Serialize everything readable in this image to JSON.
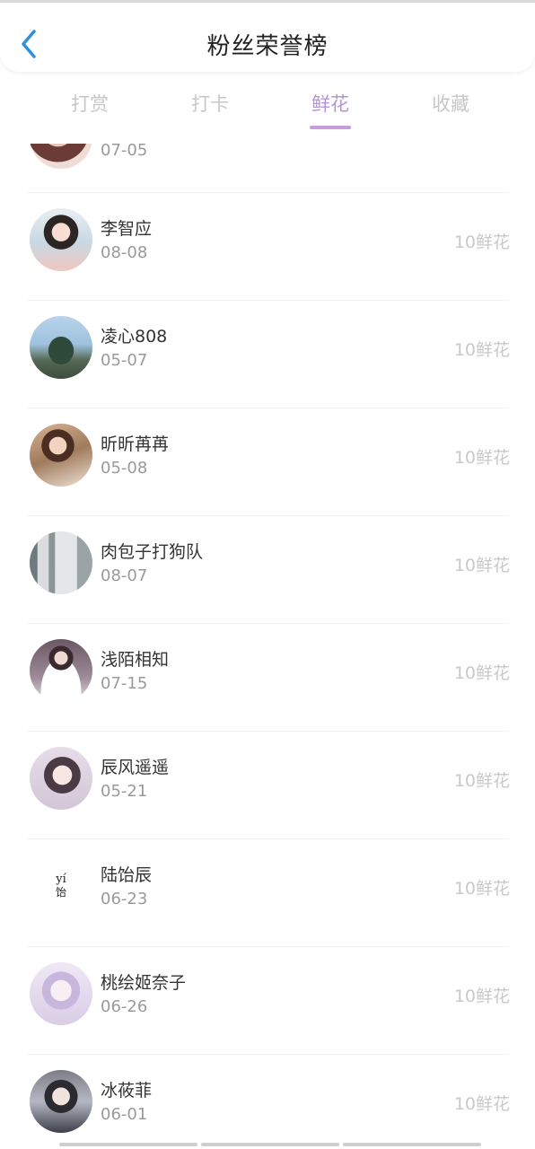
{
  "header": {
    "title": "粉丝荣誉榜",
    "back_icon": "chevron-left-icon"
  },
  "tabs": [
    {
      "label": "打赏",
      "active": false
    },
    {
      "label": "打卡",
      "active": false
    },
    {
      "label": "鲜花",
      "active": true
    },
    {
      "label": "收藏",
      "active": false
    }
  ],
  "partial_row": {
    "date": "07-05"
  },
  "rows": [
    {
      "name": "李智应",
      "date": "08-08",
      "amount": "10鲜花"
    },
    {
      "name": "凌心808",
      "date": "05-07",
      "amount": "10鲜花"
    },
    {
      "name": "昕昕苒苒",
      "date": "05-08",
      "amount": "10鲜花"
    },
    {
      "name": "肉包子打狗队",
      "date": "08-07",
      "amount": "10鲜花"
    },
    {
      "name": "浅陌相知",
      "date": "07-15",
      "amount": "10鲜花"
    },
    {
      "name": "辰风遥遥",
      "date": "05-21",
      "amount": "10鲜花"
    },
    {
      "name": "陆饴辰",
      "date": "06-23",
      "amount": "10鲜花",
      "avatar_text": "yí\n饴"
    },
    {
      "name": "桃绘姬奈子",
      "date": "06-26",
      "amount": "10鲜花"
    },
    {
      "name": "冰莜菲",
      "date": "06-01",
      "amount": "10鲜花"
    }
  ],
  "colors": {
    "accent": "#b793d8",
    "muted": "#c9c9c9",
    "date": "#9a9a9a"
  }
}
